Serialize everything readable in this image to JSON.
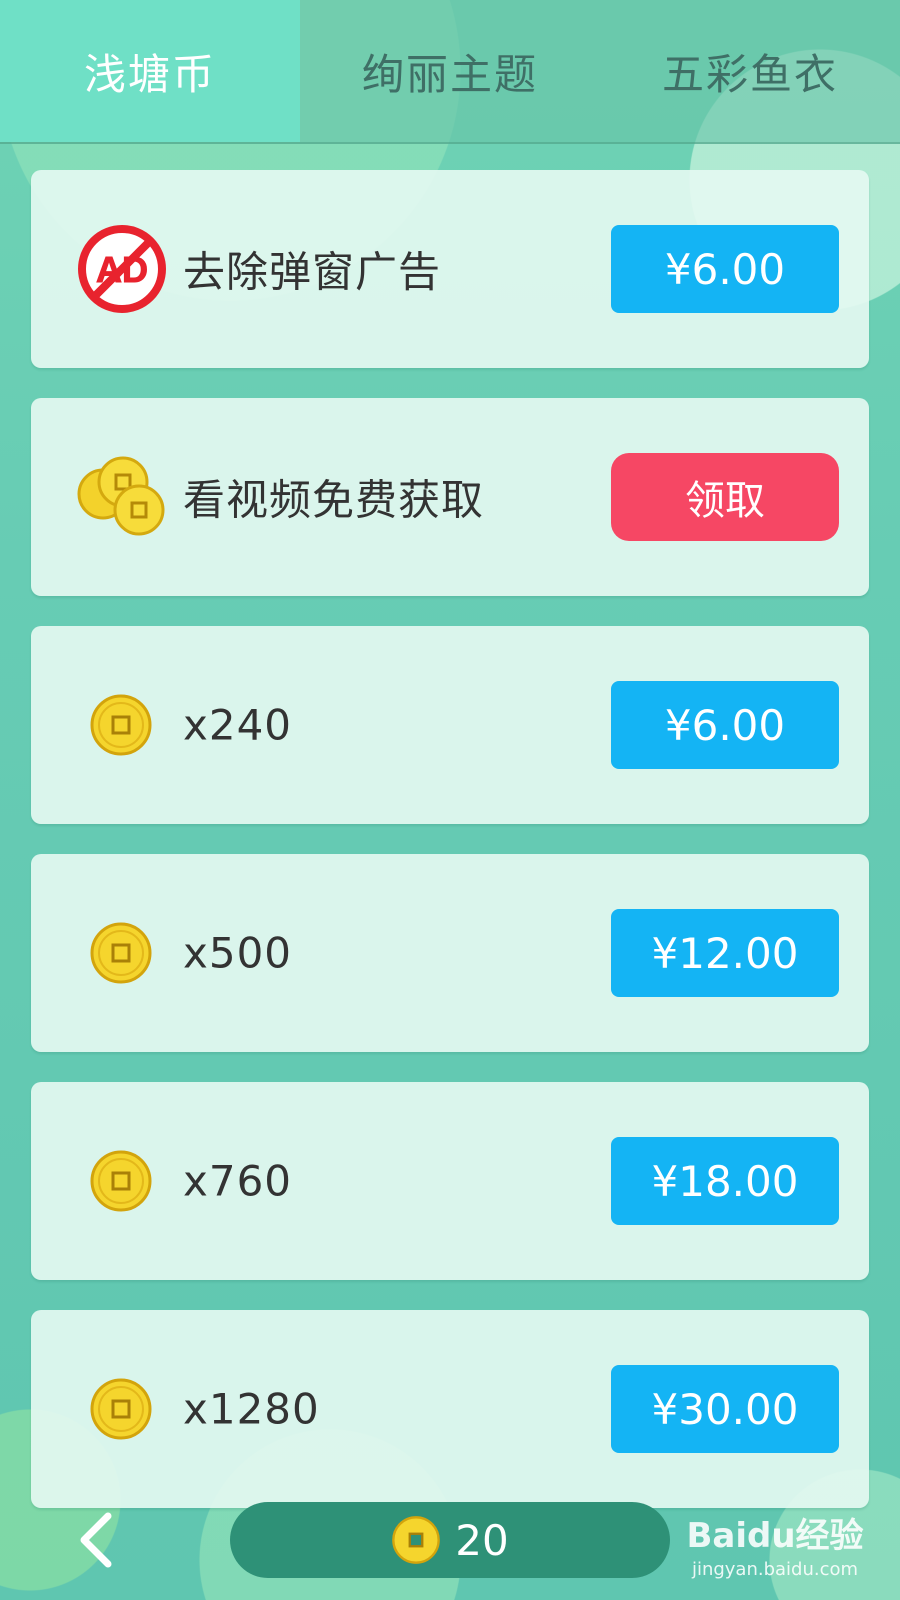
{
  "tabs": [
    {
      "label": "浅塘币",
      "active": true
    },
    {
      "label": "绚丽主题",
      "active": false
    },
    {
      "label": "五彩鱼衣",
      "active": false
    }
  ],
  "items": [
    {
      "icon": "no-ad-icon",
      "label": "去除弹窗广告",
      "button": "¥6.00",
      "button_style": "blue"
    },
    {
      "icon": "coin-stack-icon",
      "label": "看视频免费获取",
      "button": "领取",
      "button_style": "red"
    },
    {
      "icon": "coin-icon",
      "label": "x240",
      "button": "¥6.00",
      "button_style": "blue"
    },
    {
      "icon": "coin-icon",
      "label": "x500",
      "button": "¥12.00",
      "button_style": "blue"
    },
    {
      "icon": "coin-icon",
      "label": "x760",
      "button": "¥18.00",
      "button_style": "blue"
    },
    {
      "icon": "coin-icon",
      "label": "x1280",
      "button": "¥30.00",
      "button_style": "blue"
    }
  ],
  "footer": {
    "back_icon": "chevron-left-icon",
    "balance": "20"
  },
  "watermark": {
    "brand": "Baidu经验",
    "url": "jingyan.baidu.com"
  },
  "colors": {
    "tab_active": "#6fe0c6",
    "price_button": "#14b4f4",
    "claim_button": "#f64764",
    "balance_pill": "#2e9177"
  }
}
